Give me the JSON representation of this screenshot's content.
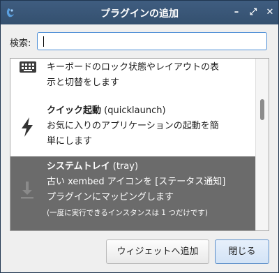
{
  "window": {
    "title": "プラグインの追加",
    "minimize_glyph": "–",
    "maximize_glyph": "⤢",
    "close_glyph": "✕"
  },
  "search": {
    "label": "検索:",
    "value": "",
    "placeholder": ""
  },
  "plugins": [
    {
      "icon": "keyboard-icon",
      "name": "",
      "id": "",
      "description_line1": "キーボードのロック状態やレイアウトの表",
      "description_line2": "示と切替をします"
    },
    {
      "icon": "lightning-icon",
      "name": "クイック起動",
      "id": "(quicklaunch)",
      "description_line1": "お気に入りのアプリケーションの起動を簡",
      "description_line2": "単にします"
    },
    {
      "icon": "tray-download-icon",
      "name": "システムトレイ",
      "id": "(tray)",
      "description_line1": "古い xembed アイコンを [ステータス通知]",
      "description_line2": "プラグインにマッピングします",
      "note": "(一度に実行できるインスタンスは 1 つだけです)",
      "selected": true
    }
  ],
  "buttons": {
    "add_widget": "ウィジェットへ追加",
    "close": "閉じる"
  },
  "colors": {
    "titlebar": "#3f5d80",
    "selection": "#6b6b6b",
    "focus": "#4f8fd6"
  }
}
